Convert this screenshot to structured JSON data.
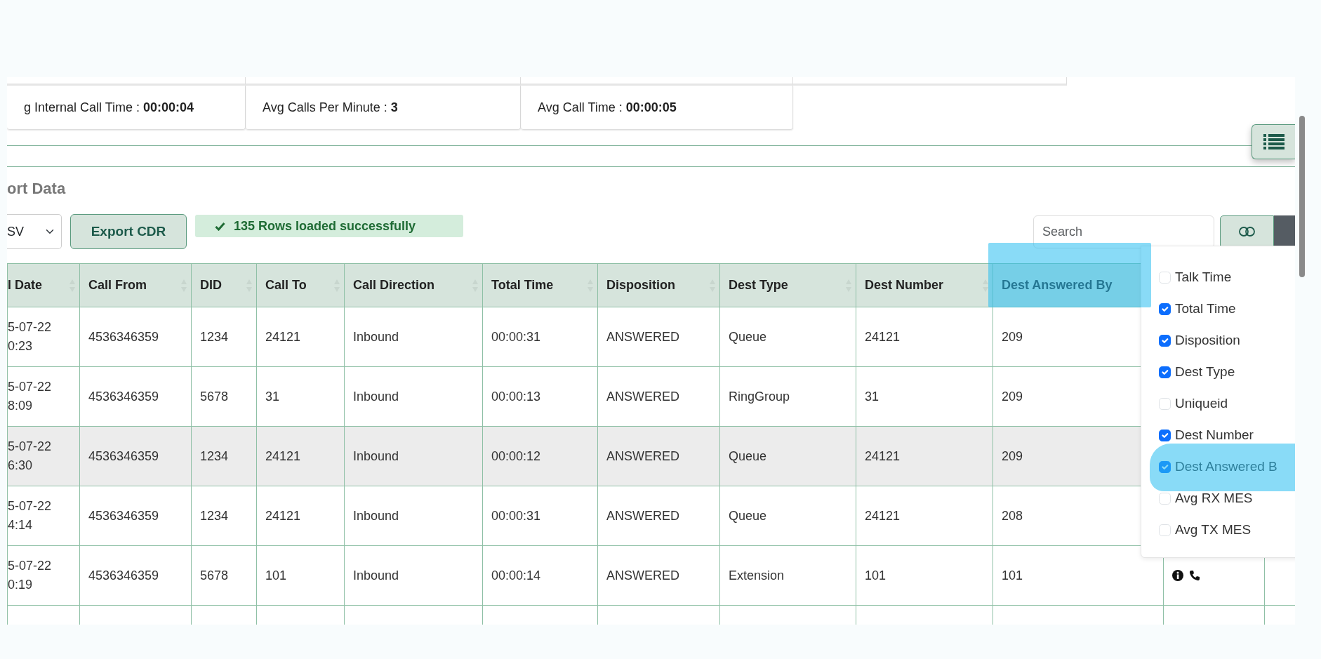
{
  "stats": [
    {
      "text": "g Internal Call Time : **00:00:04**"
    },
    {
      "text": "Avg Calls Per Minute : **3**"
    },
    {
      "text": "Avg Call Time : **00:00:05**"
    }
  ],
  "section_title": "ort Data",
  "export": {
    "format": "SV",
    "button": "Export CDR",
    "status": "135 Rows loaded successfully"
  },
  "search": {
    "placeholder": "Search"
  },
  "table": {
    "columns": [
      "l Date",
      "Call From",
      "DID",
      "Call To",
      "Call Direction",
      "Total Time",
      "Disposition",
      "Dest Type",
      "Dest Number",
      "Dest Answered By"
    ],
    "rows": [
      {
        "cells": [
          "5-07-22 0:23",
          "4536346359",
          "1234",
          "24121",
          "Inbound",
          "00:00:31",
          "ANSWERED",
          "Queue",
          "24121",
          "209"
        ],
        "hovered": false
      },
      {
        "cells": [
          "5-07-22 8:09",
          "4536346359",
          "5678",
          "31",
          "Inbound",
          "00:00:13",
          "ANSWERED",
          "RingGroup",
          "31",
          "209"
        ],
        "hovered": false
      },
      {
        "cells": [
          "5-07-22 6:30",
          "4536346359",
          "1234",
          "24121",
          "Inbound",
          "00:00:12",
          "ANSWERED",
          "Queue",
          "24121",
          "209"
        ],
        "hovered": true
      },
      {
        "cells": [
          "5-07-22 4:14",
          "4536346359",
          "1234",
          "24121",
          "Inbound",
          "00:00:31",
          "ANSWERED",
          "Queue",
          "24121",
          "208"
        ],
        "hovered": false
      },
      {
        "cells": [
          "5-07-22 0:19",
          "4536346359",
          "5678",
          "101",
          "Inbound",
          "00:00:14",
          "ANSWERED",
          "Extension",
          "101",
          "101"
        ],
        "hovered": false,
        "actions": true
      }
    ]
  },
  "column_menu": {
    "items": [
      {
        "label": "Talk Time",
        "checked": false
      },
      {
        "label": "Total Time",
        "checked": true
      },
      {
        "label": "Disposition",
        "checked": true
      },
      {
        "label": "Dest Type",
        "checked": true
      },
      {
        "label": "Uniqueid",
        "checked": false
      },
      {
        "label": "Dest Number",
        "checked": true
      },
      {
        "label": "Dest Answered B",
        "checked": true
      },
      {
        "label": "Avg RX MES",
        "checked": false
      },
      {
        "label": "Avg TX MES",
        "checked": false
      }
    ]
  }
}
